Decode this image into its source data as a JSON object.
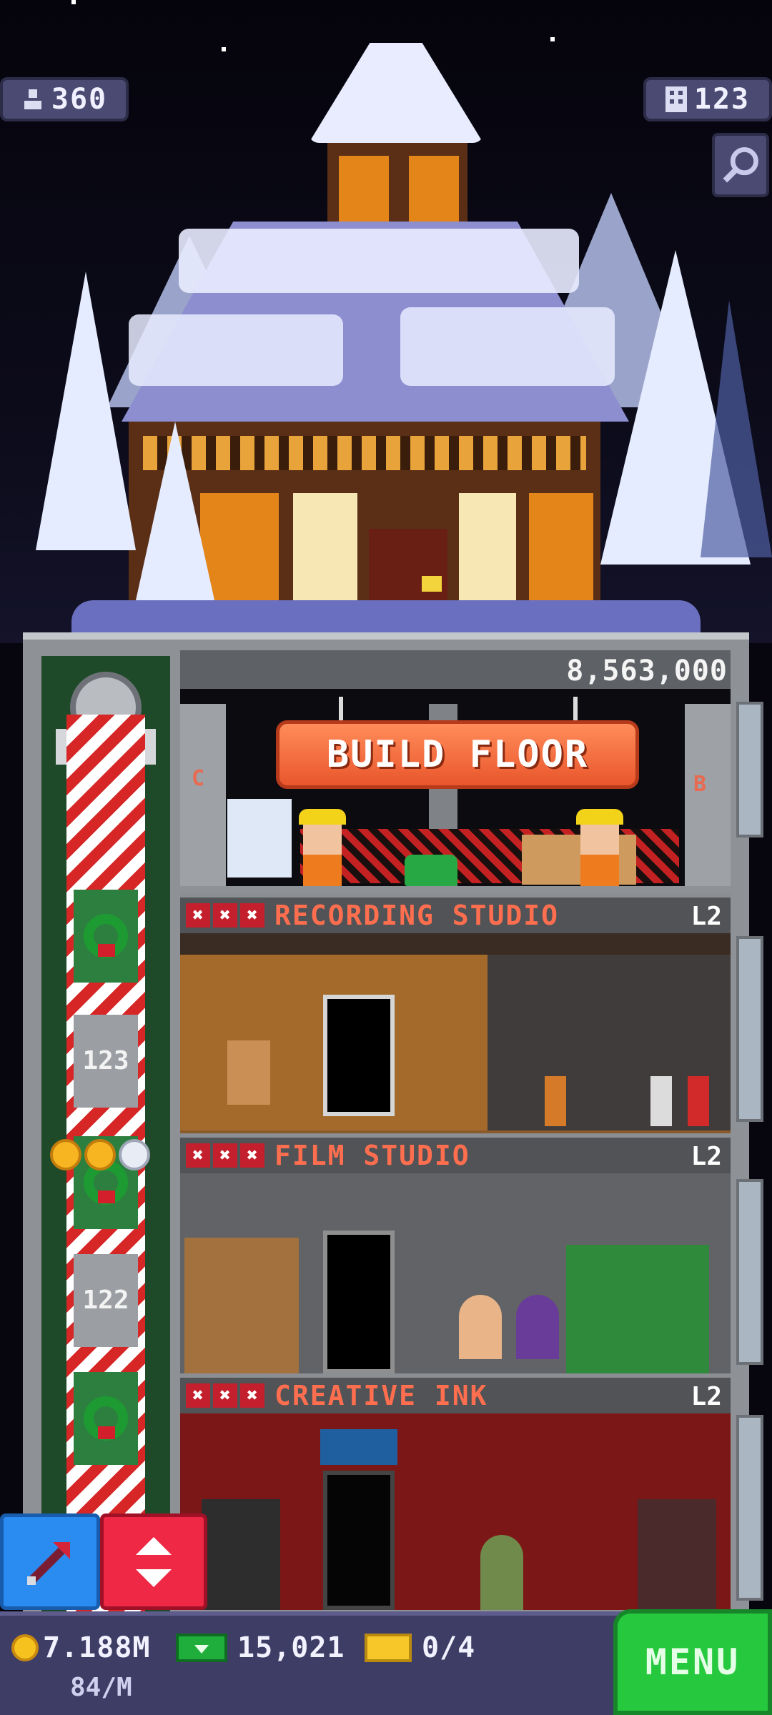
{
  "header": {
    "population": "360",
    "floors_count": "123"
  },
  "icons": {
    "population": "person-icon",
    "floors": "building-icon",
    "zoom": "magnifier-icon",
    "tool": "arrow-pointer-icon",
    "elevator": "up-down-arrows-icon",
    "coins": "coin-icon",
    "bux": "cash-icon",
    "tickets": "vip-ticket-icon"
  },
  "build": {
    "price": "8,563,000",
    "button_label": "BUILD FLOOR",
    "side_left": "C",
    "side_right": "B"
  },
  "floors": [
    {
      "name": "RECORDING STUDIO",
      "level": "L2",
      "marks": [
        "✖",
        "✖",
        "✖"
      ]
    },
    {
      "name": "FILM STUDIO",
      "level": "L2",
      "marks": [
        "✖",
        "✖",
        "✖"
      ]
    },
    {
      "name": "CREATIVE INK",
      "level": "L2",
      "marks": [
        "✖",
        "✖",
        "✖"
      ]
    }
  ],
  "elevator": {
    "floor_numbers": [
      "123",
      "122"
    ],
    "rating_stars": {
      "gold": 2,
      "total": 3
    }
  },
  "bottom_bar": {
    "coins": "7.188M",
    "income": "84/M",
    "bux": "15,021",
    "tickets": "0/4",
    "menu_label": "MENU"
  },
  "colors": {
    "menu_green": "#26c83e",
    "build_orange": "#ef6a3c",
    "label_red": "#ff6e4e",
    "tool_blue": "#2a8cf0",
    "tool_red": "#ef2846"
  }
}
